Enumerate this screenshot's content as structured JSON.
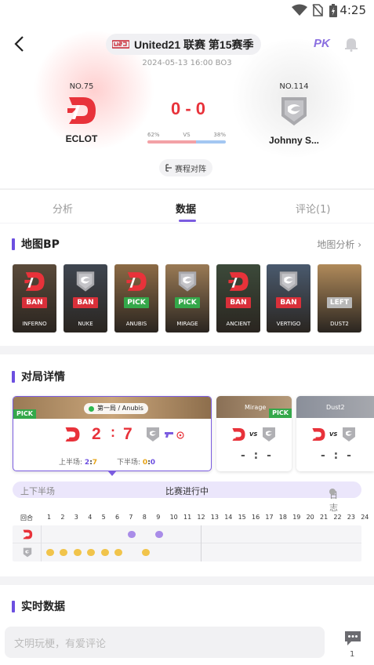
{
  "status_bar": {
    "time": "4:25"
  },
  "header": {
    "league": "United21 联赛 第15赛季",
    "datetime": "2024-05-13 16:00 BO3",
    "pk_label": "PK"
  },
  "match": {
    "team_a": {
      "rank": "NO.75",
      "name": "ECLOT",
      "color": "#e8323a"
    },
    "team_b": {
      "rank": "NO.114",
      "name": "Johnny S...",
      "color": "#9a9a9a"
    },
    "score": "0 - 0",
    "vote_left": "62%",
    "vote_vs": "VS",
    "vote_right": "38%",
    "vote_left_fraction": 0.62,
    "lineup_button": "赛程对阵"
  },
  "tabs": [
    {
      "label": "分析"
    },
    {
      "label": "数据"
    },
    {
      "label": "评论(1)"
    }
  ],
  "map_bp": {
    "title": "地图BP",
    "link": "地图分析",
    "maps": [
      {
        "name": "INFERNO",
        "action": "BAN",
        "team": "eclot",
        "bg": "#5a4a3a"
      },
      {
        "name": "NUKE",
        "action": "BAN",
        "team": "johnny",
        "bg": "#3f4650"
      },
      {
        "name": "ANUBIS",
        "action": "PICK",
        "team": "eclot",
        "bg": "#8c6a45"
      },
      {
        "name": "MIRAGE",
        "action": "PICK",
        "team": "johnny",
        "bg": "#9a7a55"
      },
      {
        "name": "ANCIENT",
        "action": "BAN",
        "team": "eclot",
        "bg": "#3c4a3a"
      },
      {
        "name": "VERTIGO",
        "action": "BAN",
        "team": "johnny",
        "bg": "#4a5a6e"
      },
      {
        "name": "DUST2",
        "action": "LEFT",
        "team": "none",
        "bg": "#b08a5a"
      }
    ]
  },
  "match_detail": {
    "title": "对局详情",
    "games": [
      {
        "label": "第一局 / Anubis",
        "pick": "PICK",
        "score_a": "2",
        "score_b": "7",
        "first_half_label": "上半场:",
        "first_half_a": "2",
        "first_half_b": "7",
        "second_half_label": "下半场:",
        "second_half_a": "0",
        "second_half_b": "0"
      },
      {
        "label": "Mirage",
        "pick": "PICK",
        "vs": "VS",
        "score": "- : -"
      },
      {
        "label": "Dust2",
        "vs": "VS",
        "score": "- : -"
      }
    ],
    "half_label": "上下半场",
    "status": "比赛进行中",
    "log_label": "日志",
    "rounds_label": "回合",
    "rounds": [
      "1",
      "2",
      "3",
      "4",
      "5",
      "6",
      "7",
      "8",
      "9",
      "10",
      "11",
      "12",
      "13",
      "14",
      "15",
      "16",
      "17",
      "18",
      "19",
      "20",
      "21",
      "22",
      "23",
      "24"
    ]
  },
  "realtime": {
    "title": "实时数据"
  },
  "comment": {
    "placeholder": "文明玩梗，有爱评论",
    "count": "1"
  }
}
